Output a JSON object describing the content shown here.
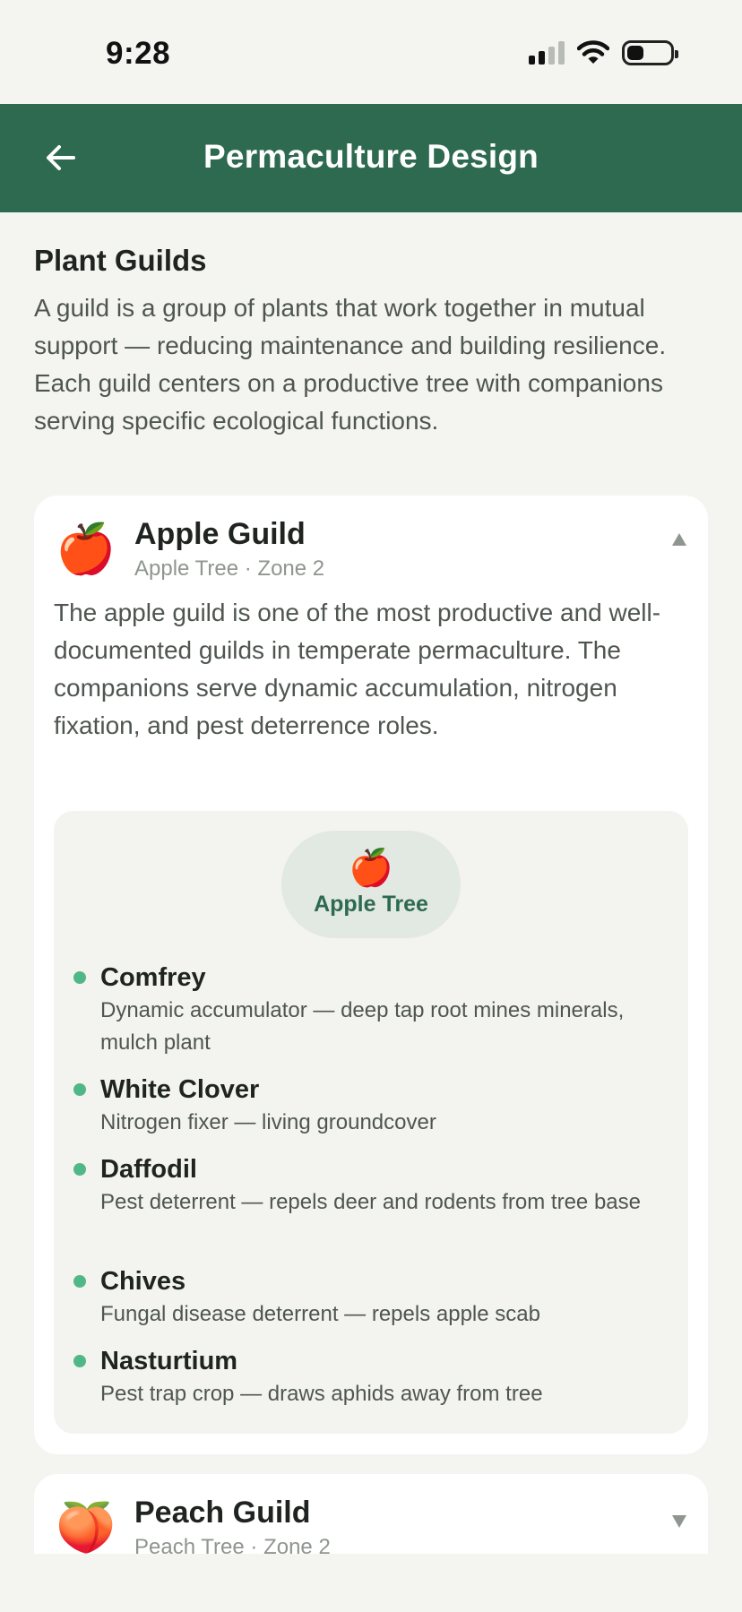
{
  "status_bar": {
    "time": "9:28"
  },
  "header": {
    "title": "Permaculture Design",
    "back_icon": "arrow-left-icon"
  },
  "section": {
    "title": "Plant Guilds",
    "description": "A guild is a group of plants that work together in mutual support — reducing maintenance and building resilience. Each guild centers on a productive tree with companions serving specific ecological functions."
  },
  "guilds": [
    {
      "emoji": "🍎",
      "name": "Apple Guild",
      "subtitle": "Apple Tree · Zone 2",
      "expanded": true,
      "description": "The apple guild is one of the most productive and well-documented guilds in temperate permaculture. The companions serve dynamic accumulation, nitrogen fixation, and pest deterrence roles.",
      "center": {
        "emoji": "🍎",
        "label": "Apple Tree"
      },
      "companions": [
        {
          "name": "Comfrey",
          "role": "Dynamic accumulator — deep tap root mines minerals, mulch plant"
        },
        {
          "name": "White Clover",
          "role": "Nitrogen fixer — living groundcover"
        },
        {
          "name": "Daffodil",
          "role": "Pest deterrent — repels deer and rodents from tree base"
        },
        {
          "name": "Chives",
          "role": "Fungal disease deterrent — repels apple scab"
        },
        {
          "name": "Nasturtium",
          "role": "Pest trap crop — draws aphids away from tree"
        }
      ]
    },
    {
      "emoji": "🍑",
      "name": "Peach Guild",
      "subtitle": "Peach Tree · Zone 2",
      "expanded": false
    }
  ],
  "colors": {
    "header": "#2d6a4f",
    "accent_dot": "#52b788",
    "background": "#f4f5f0"
  }
}
